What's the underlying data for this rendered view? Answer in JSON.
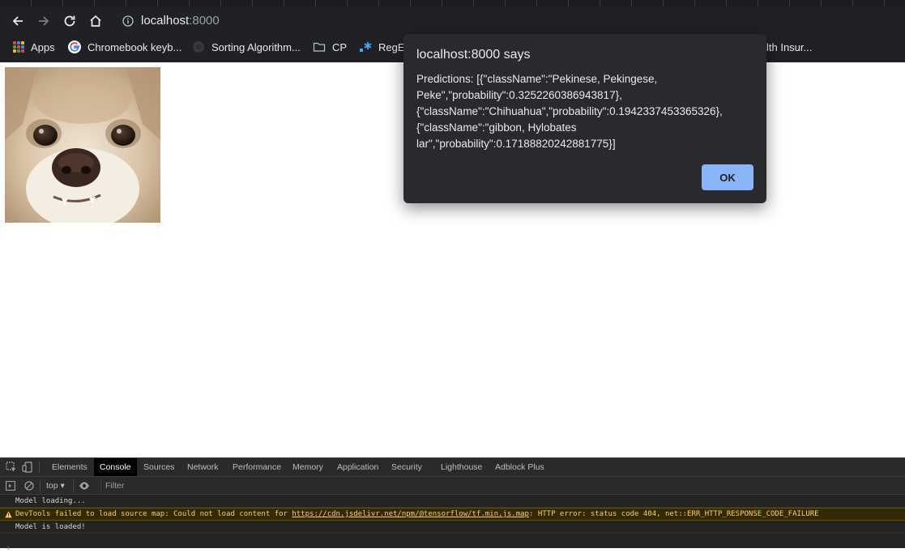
{
  "browser": {
    "url_host": "localhost",
    "url_port": ":8000"
  },
  "bookmarks": [
    {
      "label": "Apps",
      "icon": "apps-grid-icon"
    },
    {
      "label": "Chromebook keyb...",
      "icon": "google-icon"
    },
    {
      "label": "Sorting Algorithm...",
      "icon": "globe-icon"
    },
    {
      "label": "CP",
      "icon": "folder-icon"
    },
    {
      "label": "RegE",
      "icon": "regex-icon"
    },
    {
      "label": "lth Insur...",
      "icon": "none"
    }
  ],
  "page": {
    "image": "dog-photo"
  },
  "dialog": {
    "title": "localhost:8000 says",
    "message_lines": [
      "Predictions: [{\"className\":\"Pekinese, Pekingese,",
      "Peke\",\"probability\":0.3252260386943817},",
      "{\"className\":\"Chihuahua\",\"probability\":0.1942337453365326},",
      "{\"className\":\"gibbon, Hylobates",
      "lar\",\"probability\":0.17188820242881775}]"
    ],
    "ok_label": "OK"
  },
  "devtools": {
    "tabs": [
      "Elements",
      "Console",
      "Sources",
      "Network",
      "Performance",
      "Memory",
      "Application",
      "Security",
      "Lighthouse",
      "Adblock Plus"
    ],
    "active_tab": "Console",
    "context": "top ▾",
    "filter_placeholder": "Filter",
    "console": [
      {
        "type": "log",
        "text": "Model loading..."
      },
      {
        "type": "warning",
        "prefix": "DevTools failed to load source map: Could not load content for ",
        "link": "https://cdn.jsdelivr.net/npm/@tensorflow/tf.min.js.map",
        "suffix": ": HTTP error: status code 404, net::ERR_HTTP_RESPONSE_CODE_FAILURE"
      },
      {
        "type": "log",
        "text": "Model is loaded!"
      }
    ],
    "prompt": "›"
  },
  "colors": {
    "chrome_bg": "#202124",
    "dialog_bg": "#292a2d",
    "ok_button": "#8ab4f8",
    "devtools_bg": "#242424",
    "warning_text": "#ffcb6b"
  }
}
